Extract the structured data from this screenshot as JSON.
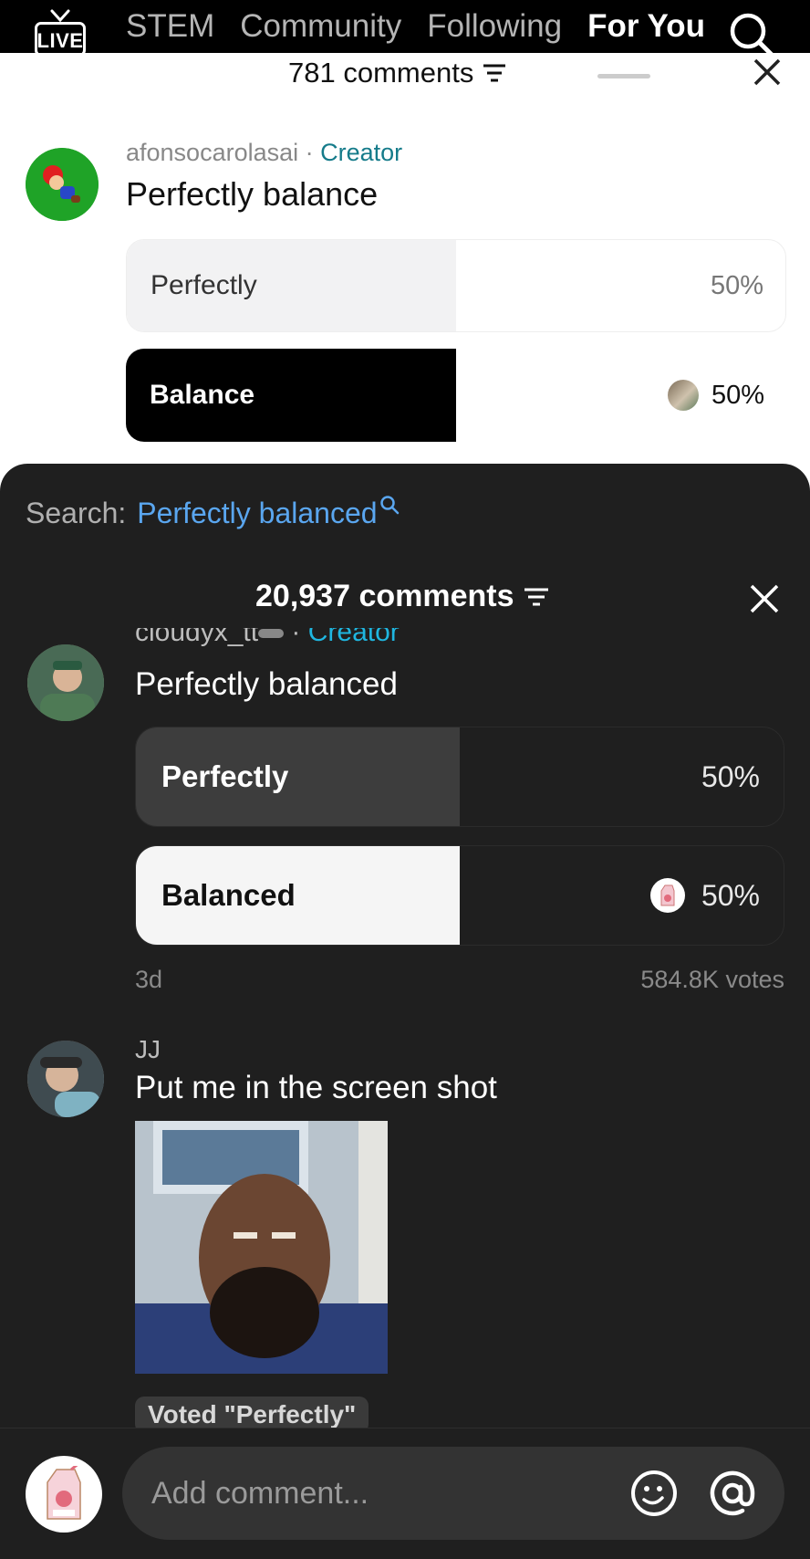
{
  "topnav": {
    "live_label": "LIVE",
    "tabs": [
      {
        "label": "STEM",
        "active": false
      },
      {
        "label": "Community",
        "active": false
      },
      {
        "label": "Following",
        "active": false
      },
      {
        "label": "For You",
        "active": true
      }
    ],
    "search_icon": "search-icon"
  },
  "light_sheet": {
    "comments_count": "781 comments",
    "comment": {
      "username": "afonsocarolasai",
      "separator": " · ",
      "badge": "Creator",
      "text": "Perfectly balance",
      "poll": [
        {
          "label": "Perfectly",
          "percent_text": "50%",
          "fill": 0.5
        },
        {
          "label": "Balance",
          "percent_text": "50%",
          "fill": 0.5,
          "voted": true
        }
      ]
    }
  },
  "dark_panel": {
    "search_label": "Search:",
    "search_term": "Perfectly balanced",
    "comments_count": "20,937 comments",
    "comment": {
      "username": "cloudyx_tt",
      "separator": " · ",
      "badge": "Creator",
      "text": "Perfectly balanced",
      "poll": [
        {
          "label": "Perfectly",
          "percent_text": "50%",
          "fill": 0.5
        },
        {
          "label": "Balanced",
          "percent_text": "50%",
          "fill": 0.5,
          "voted": true
        }
      ],
      "age": "3d",
      "votes": "584.8K votes"
    },
    "reply": {
      "username": "JJ",
      "text": "Put me in the screen shot",
      "voted_badge": "Voted \"Perfectly\""
    },
    "input": {
      "placeholder": "Add comment..."
    }
  },
  "colors": {
    "creator_light": "#157b8a",
    "creator_dark": "#1fb6e0",
    "search_term": "#5aa6ef",
    "dark_bg": "#1f1f1f"
  }
}
